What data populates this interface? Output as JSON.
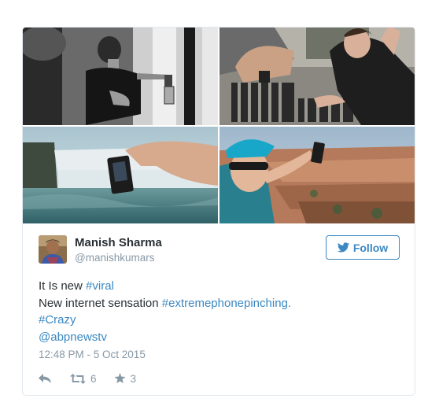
{
  "tweet": {
    "author": {
      "display_name": "Manish Sharma",
      "screen_name": "@manishkumars"
    },
    "follow_label": "Follow",
    "text": {
      "line1_prefix": "It Is new ",
      "line1_hashtag": "#viral",
      "line2_prefix": "New internet sensation ",
      "line2_hashtag": "#extremephonepinching.",
      "line3_hashtag": "#Crazy",
      "line4_mention": "@abpnewstv"
    },
    "timestamp": "12:48 PM - 5 Oct 2015",
    "retweet_count": "6",
    "like_count": "3",
    "icons": {
      "follow": "twitter-bird-icon",
      "reply": "reply-icon",
      "retweet": "retweet-icon",
      "like": "star-icon"
    },
    "colors": {
      "link": "#3b88c3",
      "muted": "#8899a6",
      "text": "#292f33",
      "border": "#e1e8ed"
    }
  }
}
